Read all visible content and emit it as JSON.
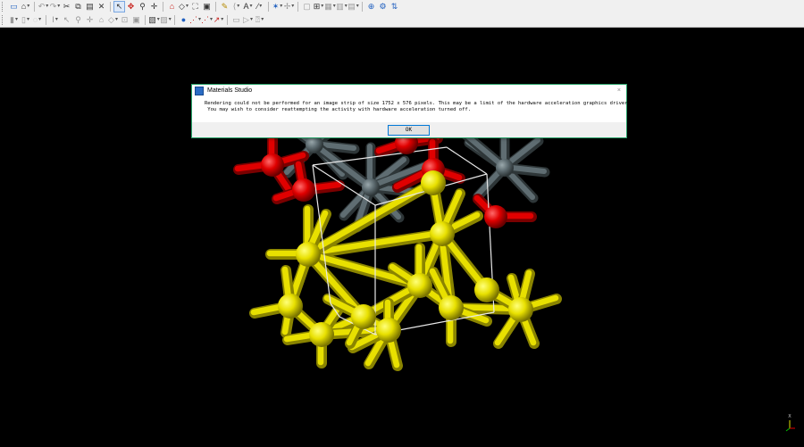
{
  "dialog": {
    "title": "Materials Studio",
    "message_line1": "Rendering could not be performed for an image strip of size 1752 x 576 pixels. This may be a limit of the hardware acceleration graphics driver.",
    "message_line2": " You may wish to consider reattempting the activity with hardware acceleration turned off.",
    "ok_label": "OK",
    "close_label": "×"
  },
  "axes": {
    "x_label": "X",
    "y_label": "Y",
    "z_label": "Z"
  },
  "colors": {
    "background": "#000000",
    "toolbar": "#f0f0f0",
    "dialog_border": "#29a36a",
    "atom_yellow": "#e8e000",
    "atom_red": "#e00000",
    "atom_gray": "#5f6d72",
    "cell_lines": "#e8e8e8"
  },
  "icons": [
    "new-document-icon",
    "undo-icon",
    "redo-icon",
    "cut-icon",
    "copy-icon",
    "paste-icon",
    "select-pointer-icon",
    "rotate-icon",
    "zoom-icon",
    "pan-icon",
    "home-icon",
    "fit-view-icon",
    "sketch-pencil-icon",
    "atom-icon",
    "bond-icon",
    "symmetry-icon",
    "cell-icon",
    "display-style-icon",
    "color-icon",
    "label-icon",
    "help-icon"
  ]
}
